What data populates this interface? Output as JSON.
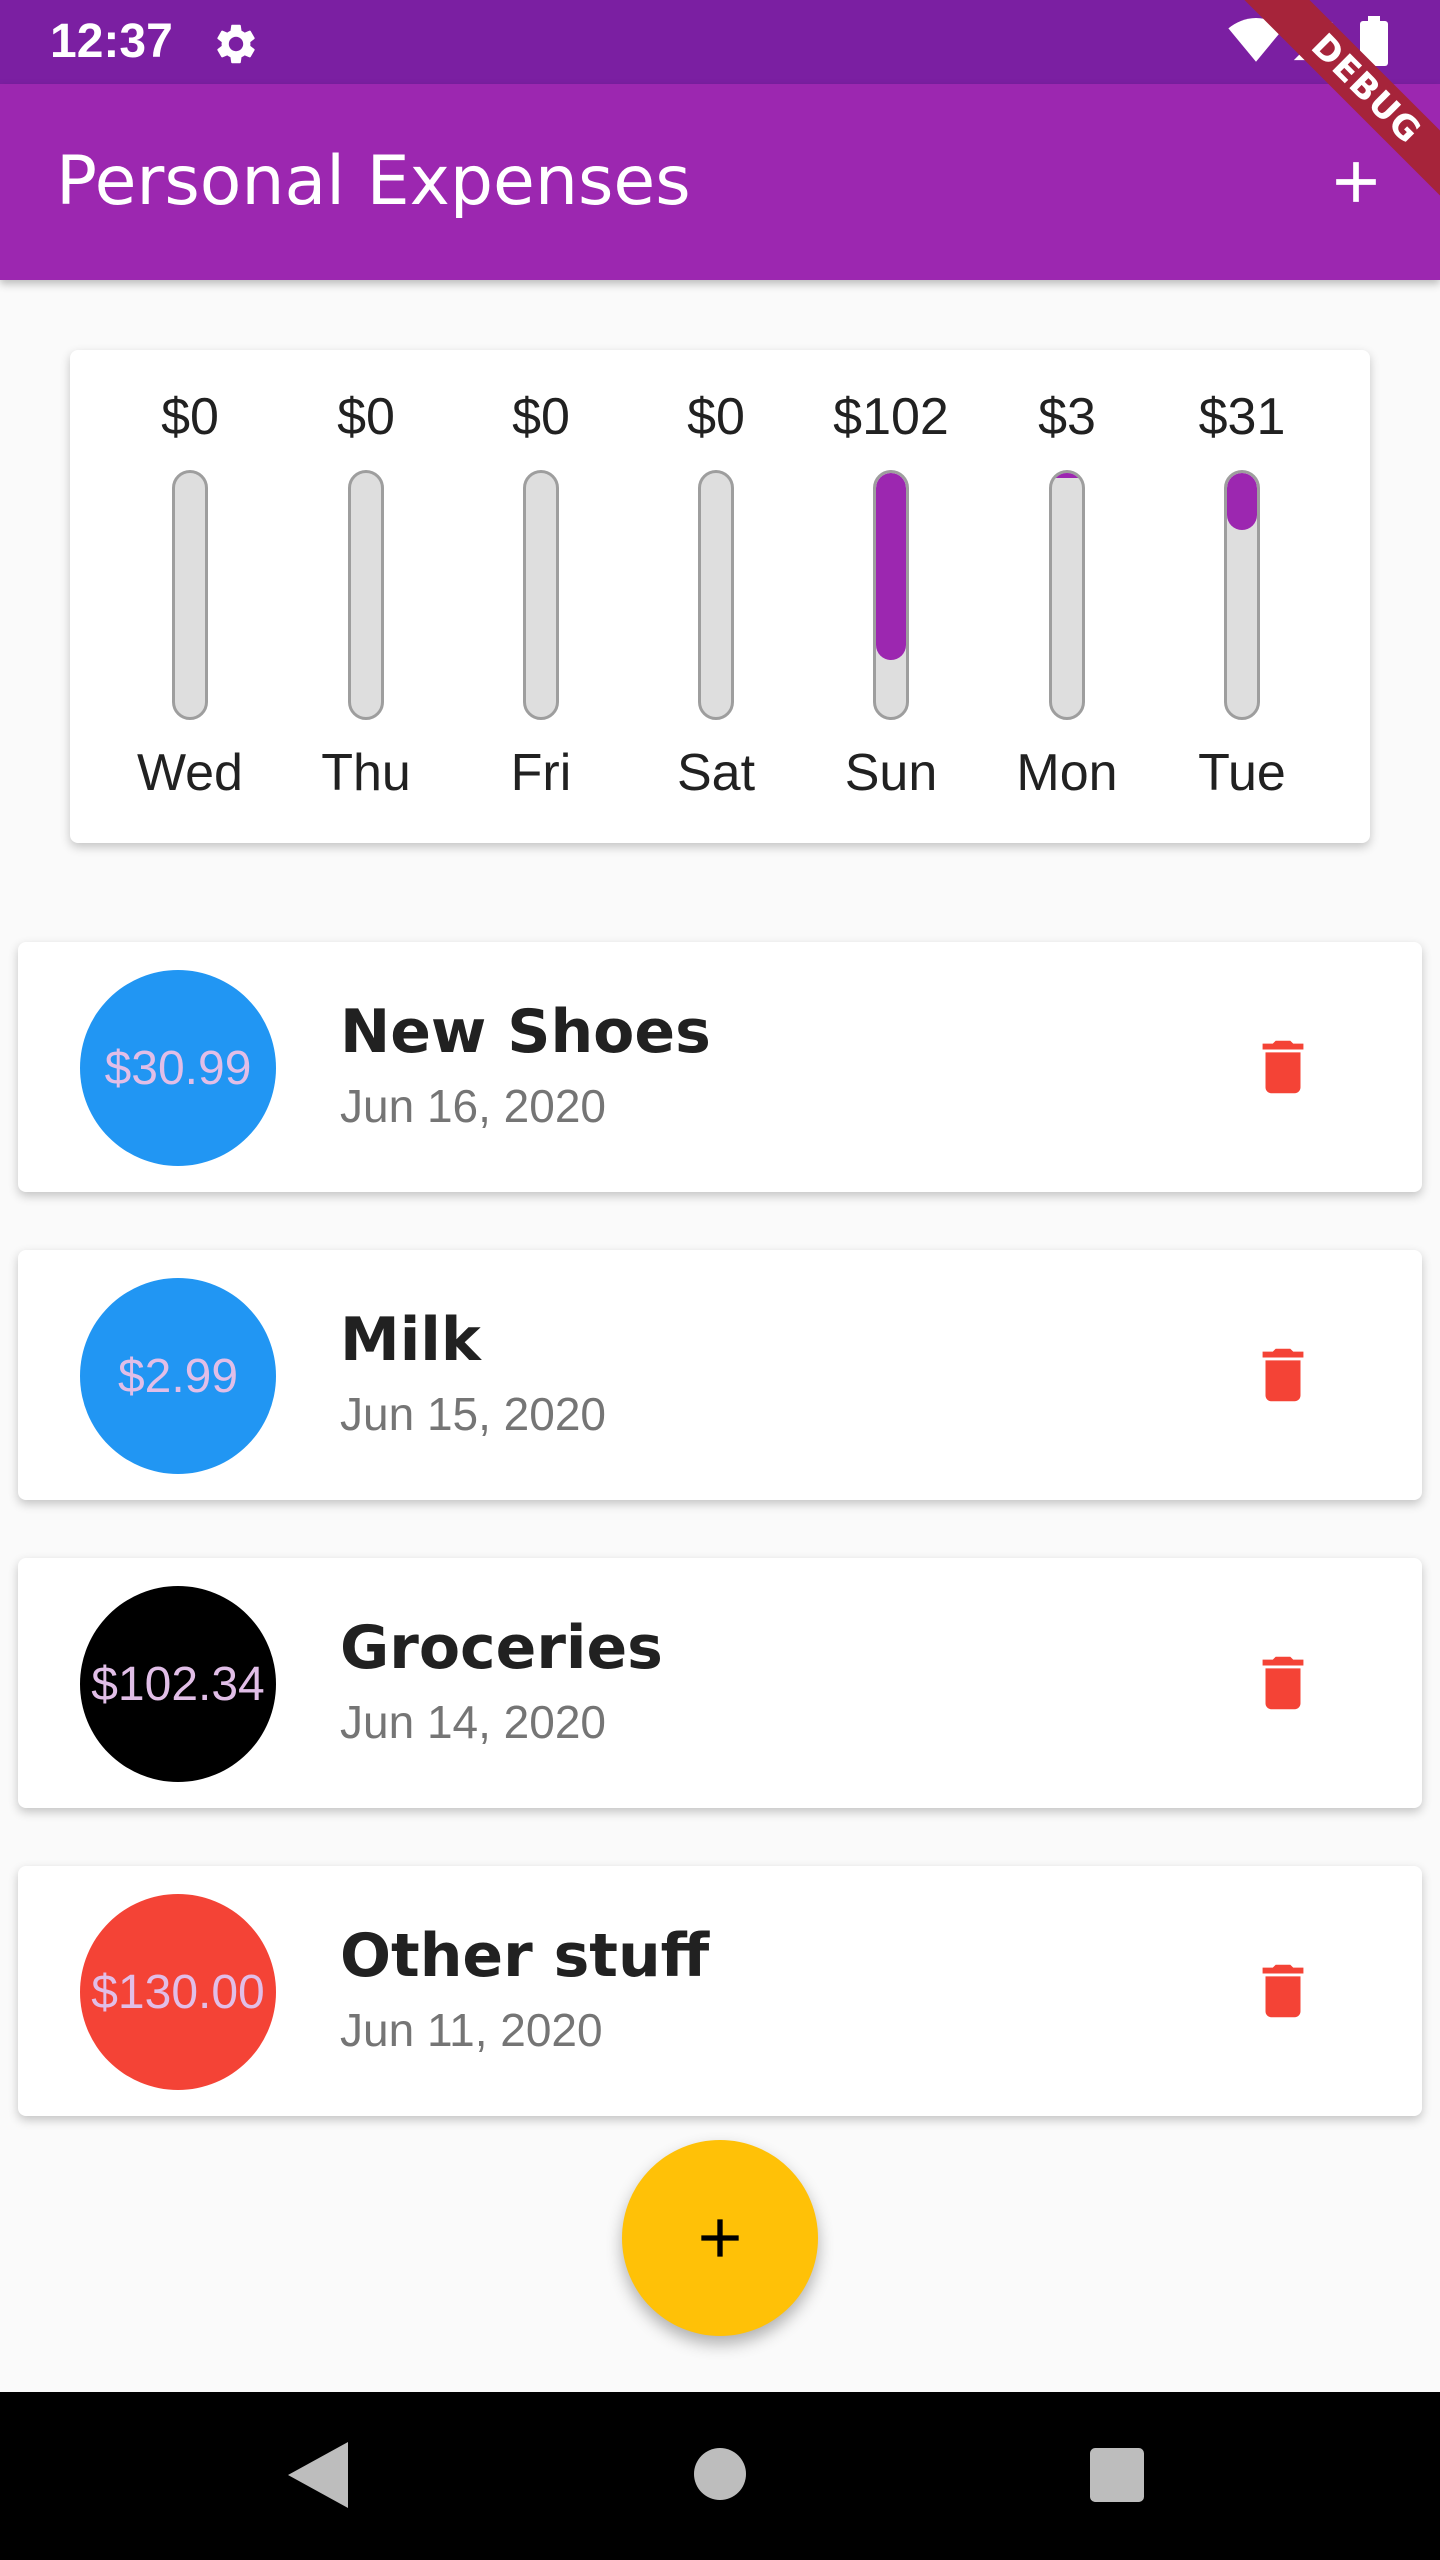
{
  "status_bar": {
    "time": "12:37",
    "icons": [
      "gear-icon",
      "wifi-icon",
      "signal-icon",
      "battery-icon"
    ]
  },
  "app_bar": {
    "title": "Personal Expenses",
    "add_icon": "plus-icon",
    "color": "#9c27b0"
  },
  "debug_banner": "DEBUG",
  "chart": {
    "days": [
      {
        "amount": "$0",
        "day": "Wed",
        "fraction": 0
      },
      {
        "amount": "$0",
        "day": "Thu",
        "fraction": 0
      },
      {
        "amount": "$0",
        "day": "Fri",
        "fraction": 0
      },
      {
        "amount": "$0",
        "day": "Sat",
        "fraction": 0
      },
      {
        "amount": "$102",
        "day": "Sun",
        "fraction": 0.766
      },
      {
        "amount": "$3",
        "day": "Mon",
        "fraction": 0.022
      },
      {
        "amount": "$31",
        "day": "Tue",
        "fraction": 0.233
      }
    ],
    "fill_color": "#9c27b0"
  },
  "transactions": [
    {
      "amount": "$30.99",
      "title": "New Shoes",
      "date": "Jun 16, 2020",
      "avatar_color": "#2196f3"
    },
    {
      "amount": "$2.99",
      "title": "Milk",
      "date": "Jun 15, 2020",
      "avatar_color": "#2196f3"
    },
    {
      "amount": "$102.34",
      "title": "Groceries",
      "date": "Jun 14, 2020",
      "avatar_color": "#000000"
    },
    {
      "amount": "$130.00",
      "title": "Other stuff",
      "date": "Jun 11, 2020",
      "avatar_color": "#f44336"
    }
  ],
  "delete_icon": "trash-icon",
  "delete_color": "#f44336",
  "fab": {
    "icon": "plus-icon",
    "color": "#ffc107"
  },
  "nav_bar": {
    "icons": [
      "back-icon",
      "home-icon",
      "recents-icon"
    ]
  }
}
